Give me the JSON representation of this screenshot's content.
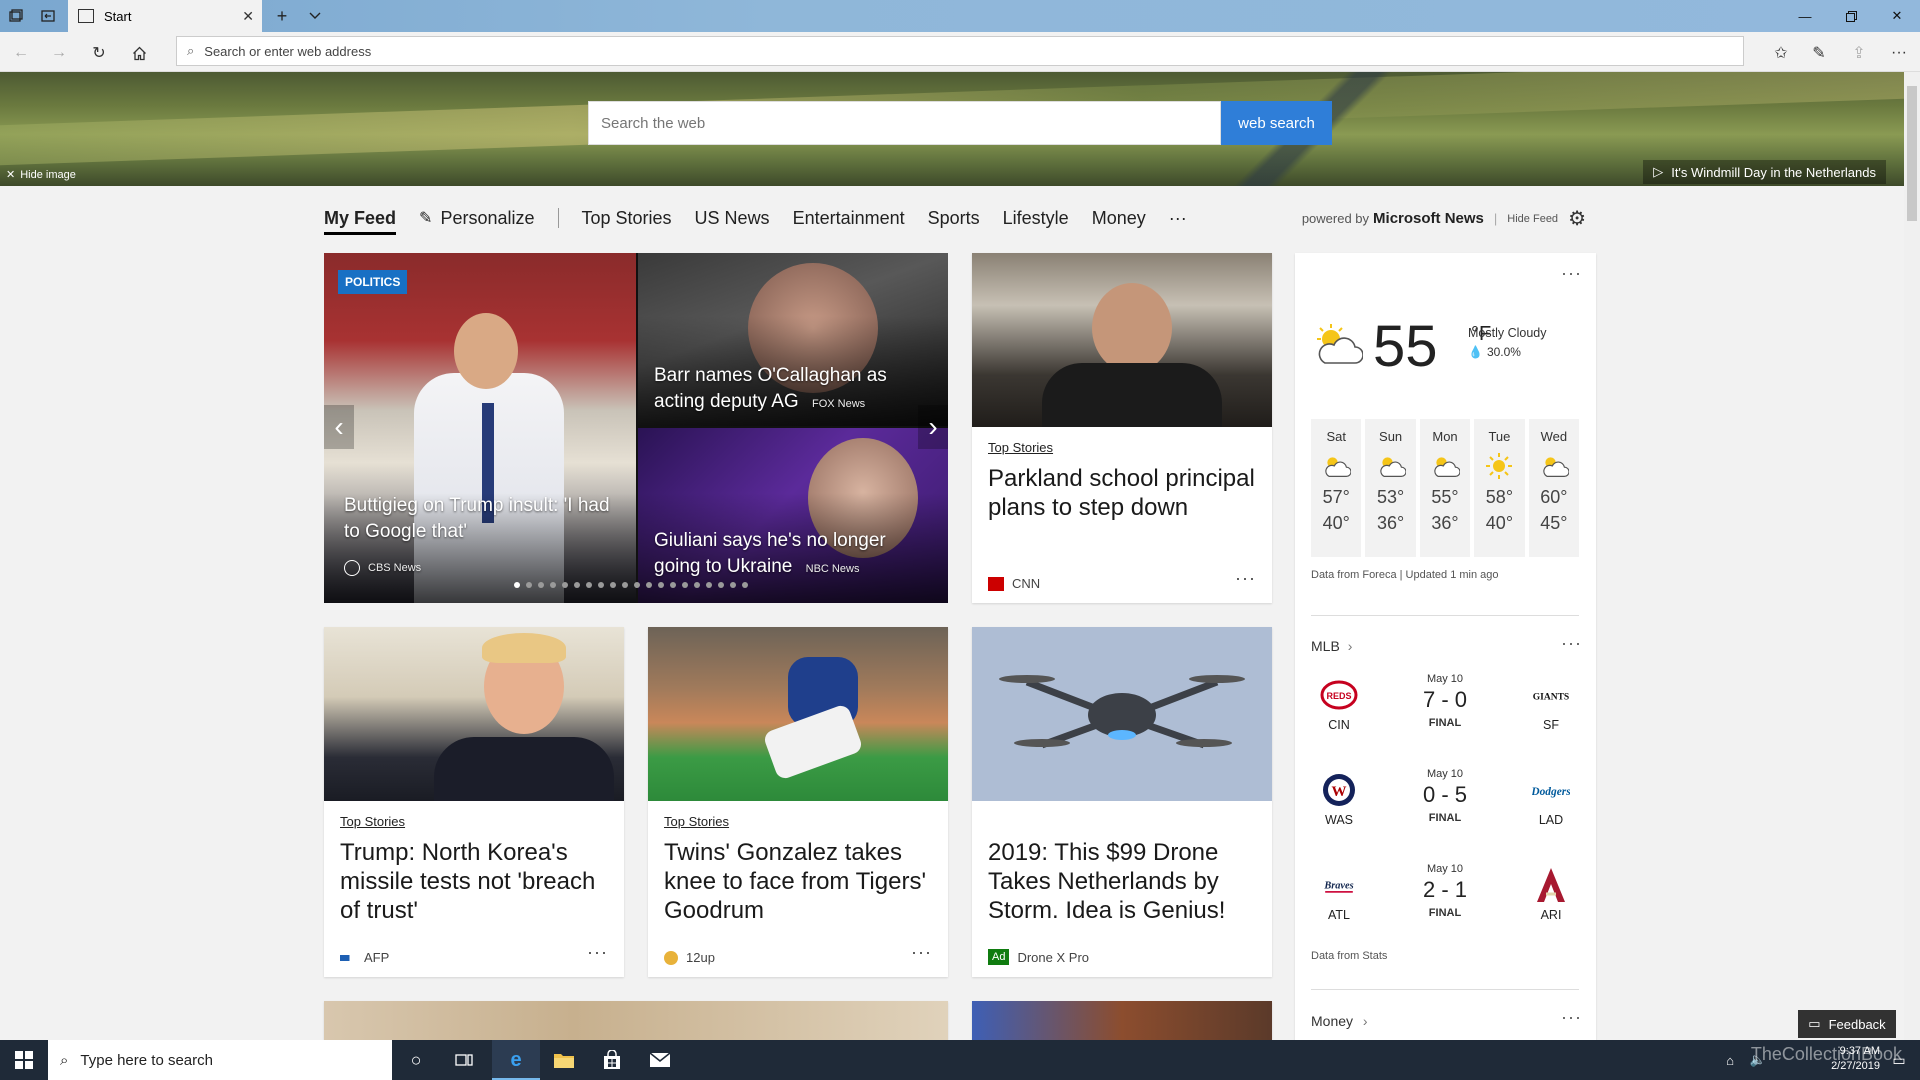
{
  "browser": {
    "tab_title": "Start",
    "address_placeholder": "Search or enter web address"
  },
  "hero": {
    "search_placeholder": "Search the web",
    "search_button": "web search",
    "hide_image": "Hide image",
    "caption": "It's Windmill Day in the Netherlands"
  },
  "feednav": {
    "items": [
      "My Feed",
      "Personalize",
      "Top Stories",
      "US News",
      "Entertainment",
      "Sports",
      "Lifestyle",
      "Money",
      "···"
    ],
    "powered_by": "powered by",
    "provider": "Microsoft News",
    "hide_feed": "Hide Feed"
  },
  "carousel": {
    "badge": "POLITICS",
    "main_headline": "Buttigieg on Trump insult: 'I had to Google that'",
    "main_source": "CBS News",
    "top_headline": "Barr names O'Callaghan as acting deputy AG",
    "top_source": "FOX News",
    "bottom_headline": "Giuliani says he's no longer going to Ukraine",
    "bottom_source": "NBC News"
  },
  "cards": [
    {
      "category": "Top Stories",
      "headline": "Parkland school principal plans to step down",
      "source": "CNN"
    },
    {
      "category": "Top Stories",
      "headline": "Trump: North Korea's missile tests not 'breach of trust'",
      "source": "AFP"
    },
    {
      "category": "Top Stories",
      "headline": "Twins' Gonzalez takes knee to face from Tigers' Goodrum",
      "source": "12up"
    },
    {
      "category": "",
      "headline": "2019: This $99 Drone Takes Netherlands by Storm. Idea is Genius!",
      "source": "Drone X Pro",
      "ad_label": "Ad"
    }
  ],
  "weather": {
    "temp": "55",
    "unit": "°F",
    "condition": "Mostly Cloudy",
    "precip": "30.0%",
    "forecast": [
      {
        "day": "Sat",
        "hi": "57°",
        "lo": "40°",
        "icon": "partly-cloudy-icon"
      },
      {
        "day": "Sun",
        "hi": "53°",
        "lo": "36°",
        "icon": "partly-cloudy-icon"
      },
      {
        "day": "Mon",
        "hi": "55°",
        "lo": "36°",
        "icon": "partly-cloudy-icon"
      },
      {
        "day": "Tue",
        "hi": "58°",
        "lo": "40°",
        "icon": "sunny-icon"
      },
      {
        "day": "Wed",
        "hi": "60°",
        "lo": "45°",
        "icon": "partly-cloudy-icon"
      }
    ],
    "credit": "Data from Foreca | Updated 1 min ago"
  },
  "mlb": {
    "title": "MLB",
    "games": [
      {
        "date": "May 10",
        "score": "7 - 0",
        "status": "FINAL",
        "away": "CIN",
        "home": "SF"
      },
      {
        "date": "May 10",
        "score": "0 - 5",
        "status": "FINAL",
        "away": "WAS",
        "home": "LAD"
      },
      {
        "date": "May 10",
        "score": "2 - 1",
        "status": "FINAL",
        "away": "ATL",
        "home": "ARI"
      }
    ],
    "credit": "Data from Stats",
    "money_title": "Money"
  },
  "feedback": "Feedback",
  "taskbar": {
    "search_placeholder": "Type here to search",
    "time": "9:37 AM",
    "date": "2/27/2019",
    "watermark": "TheCollectionBook"
  },
  "colors": {
    "accent": "#2f7ed8",
    "politics_badge": "#1870c4",
    "taskbar": "#1f2a38"
  }
}
